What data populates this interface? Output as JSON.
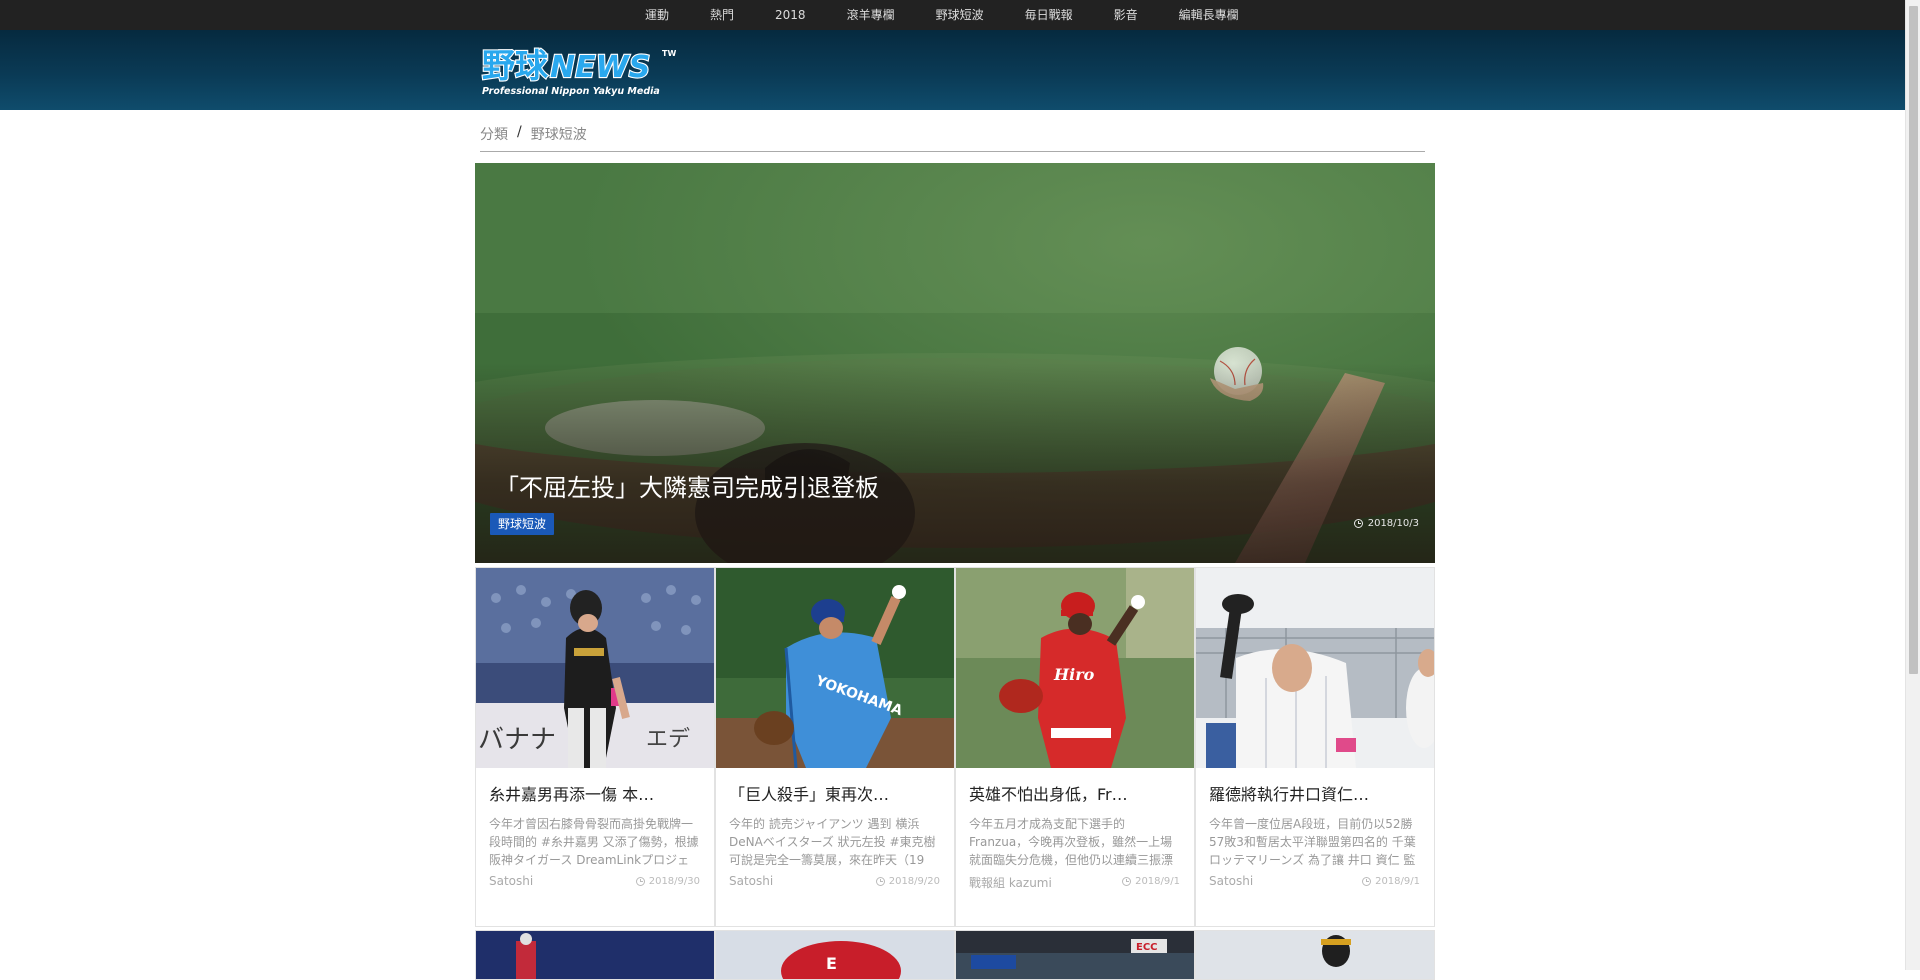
{
  "topnav": {
    "items": [
      "運動",
      "熱門",
      "2018",
      "滾羊專欄",
      "野球短波",
      "毎日戰報",
      "影音",
      "編輯長專欄"
    ]
  },
  "logo": {
    "text": "野球NEWS",
    "superscript": "TW",
    "tagline": "Professional Nippon Yakyu Media"
  },
  "breadcrumb": {
    "root": "分類",
    "separator": "/",
    "current": "野球短波"
  },
  "hero": {
    "title": "「不屈左投」大隣憲司完成引退登板",
    "tag": "野球短波",
    "date": "2018/10/3",
    "clock_icon": "clock-icon"
  },
  "cards": [
    {
      "title": "糸井嘉男再添一傷 本…",
      "excerpt": "今年才曾因右膝骨骨裂而高掛免戰牌一段時間的 #糸井嘉男 又添了傷勢，根據 阪神タイガース DreamLinkプロジェクト",
      "author": "Satoshi",
      "date": "2018/9/30"
    },
    {
      "title": "「巨人殺手」東再次…",
      "excerpt": "今年的 読売ジャイアンツ 遇到 横浜DeNAベイスターズ 狀元左投 #東克樹 可說是完全一籌莫展，來在昨天（19",
      "author": "Satoshi",
      "date": "2018/9/20"
    },
    {
      "title": "英雄不怕出身低，Fr…",
      "excerpt": "今年五月才成為支配下選手的 Franzua，今晚再次登板，雖然一上場就面臨失分危機，但他仍以連續三振漂",
      "author": "戰報組 kazumi",
      "date": "2018/9/1"
    },
    {
      "title": "羅德將執行井口資仁…",
      "excerpt": "今年曾一度位居A段班，目前仍以52勝57敗3和暫居太平洋聯盟第四名的 千葉ロッテマリーンズ 為了讓 井口 資仁 監",
      "author": "Satoshi",
      "date": "2018/9/1"
    }
  ],
  "colors": {
    "topnav_bg": "#222222",
    "header_bg": "#0a3a55",
    "tag_bg": "#1a59b8"
  }
}
